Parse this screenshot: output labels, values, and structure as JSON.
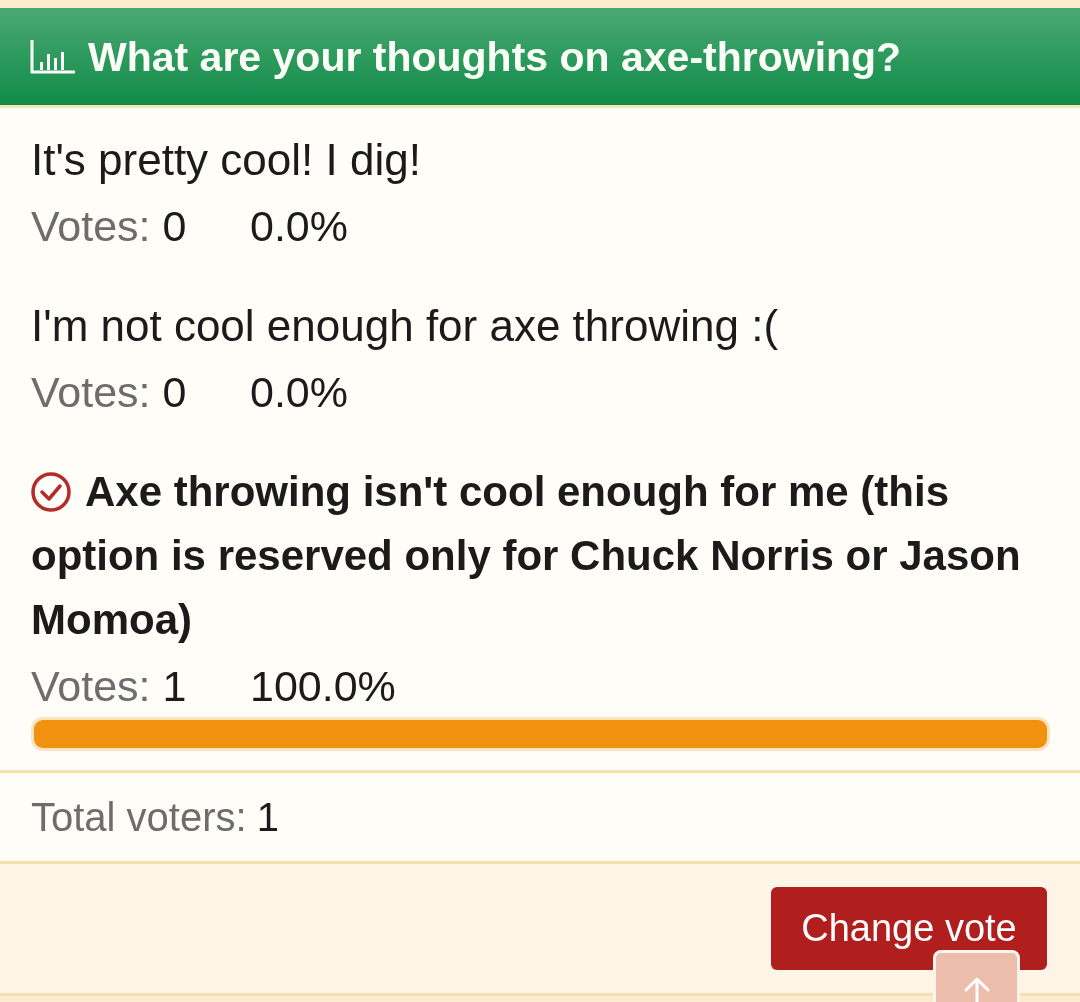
{
  "poll": {
    "title": "What are your thoughts on axe-throwing?",
    "options": [
      {
        "label": "It's pretty cool! I dig!",
        "selected": false,
        "votes_label": "Votes:",
        "votes": "0",
        "percent": "0.0%"
      },
      {
        "label": "I'm not cool enough for axe throwing :(",
        "selected": false,
        "votes_label": "Votes:",
        "votes": "0",
        "percent": "0.0%"
      },
      {
        "label": "Axe throwing isn't cool enough for me (this option is reserved only for Chuck Norris or Jason Momoa)",
        "selected": true,
        "votes_label": "Votes:",
        "votes": "1",
        "percent": "100.0%",
        "level": 1
      }
    ]
  },
  "total": {
    "label": "Total voters:",
    "value": "1"
  },
  "buttons": [
    {
      "label": "Change vote"
    }
  ]
}
